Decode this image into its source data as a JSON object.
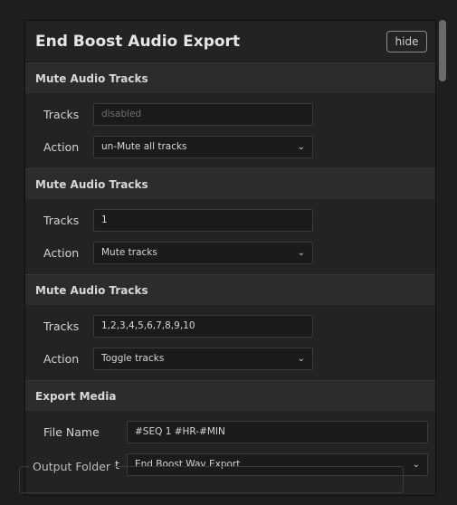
{
  "panel": {
    "title": "End Boost Audio Export",
    "hide_label": "hide"
  },
  "sections": [
    {
      "header": "Mute Audio Tracks",
      "tracks_label": "Tracks",
      "tracks_value": "",
      "tracks_placeholder": "disabled",
      "action_label": "Action",
      "action_value": "un-Mute all tracks"
    },
    {
      "header": "Mute Audio Tracks",
      "tracks_label": "Tracks",
      "tracks_value": "1",
      "action_label": "Action",
      "action_value": "Mute tracks"
    },
    {
      "header": "Mute Audio Tracks",
      "tracks_label": "Tracks",
      "tracks_value": "1,2,3,4,5,6,7,8,9,10",
      "action_label": "Action",
      "action_value": "Toggle tracks"
    }
  ],
  "export": {
    "header": "Export Media",
    "file_name_label": "File Name",
    "file_name_value": "#SEQ 1 #HR-#MIN",
    "preset_label": "Export Preset",
    "preset_value": "End Boost Wav Export",
    "output_folder_label": "Output Folder"
  },
  "icons": {
    "chevron": "chevron-down-icon",
    "chevron_glyph": "⌄"
  },
  "colors": {
    "background": "#1e1e1e",
    "panel": "#232323",
    "section_header": "#2c2c2c",
    "field": "#1b1b1b"
  }
}
